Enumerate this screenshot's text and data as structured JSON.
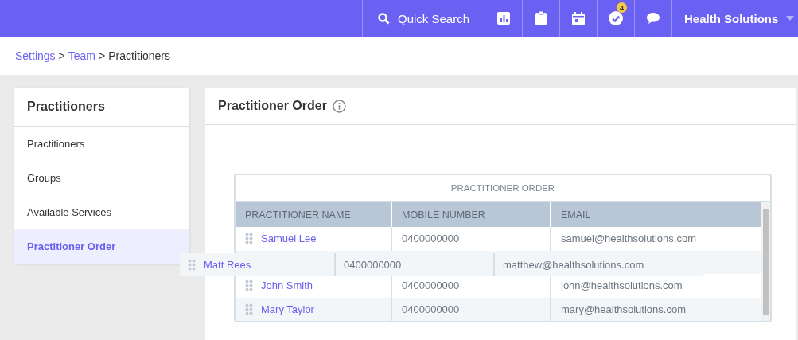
{
  "topbar": {
    "search_label": "Quick Search",
    "icons": [
      {
        "kind": "chart"
      },
      {
        "kind": "clipboard"
      },
      {
        "kind": "calendar"
      },
      {
        "kind": "tasks",
        "badge": "4"
      },
      {
        "kind": "chat"
      }
    ],
    "account": "Health Solutions"
  },
  "breadcrumb": [
    {
      "label": "Settings",
      "link": true
    },
    {
      "label": ">",
      "link": false
    },
    {
      "label": "Team",
      "link": true
    },
    {
      "label": ">",
      "link": false
    },
    {
      "label": "Practitioners",
      "link": false
    }
  ],
  "sidebar": {
    "title": "Practitioners",
    "items": [
      {
        "label": "Practitioners",
        "selected": false
      },
      {
        "label": "Groups",
        "selected": false
      },
      {
        "label": "Available Services",
        "selected": false
      },
      {
        "label": "Practitioner Order",
        "selected": true
      }
    ]
  },
  "main": {
    "title": "Practitioner Order",
    "table": {
      "caption": "PRACTITIONER ORDER",
      "columns": [
        "PRACTITIONER NAME",
        "MOBILE NUMBER",
        "EMAIL"
      ],
      "rows": [
        {
          "kind": "row",
          "name": "Samuel Lee",
          "mobile": "0400000000",
          "email": "samuel@healthsolutions.com"
        },
        {
          "kind": "placeholder"
        },
        {
          "kind": "row",
          "name": "John Smith",
          "mobile": "0400000000",
          "email": "john@healthsolutions.com"
        },
        {
          "kind": "row",
          "name": "Mary Taylor",
          "mobile": "0400000000",
          "email": "mary@healthsolutions.com"
        }
      ],
      "dragged_row": {
        "name": "Matt Rees",
        "mobile": "0400000000",
        "email": "matthew@healthsolutions.com"
      }
    }
  }
}
